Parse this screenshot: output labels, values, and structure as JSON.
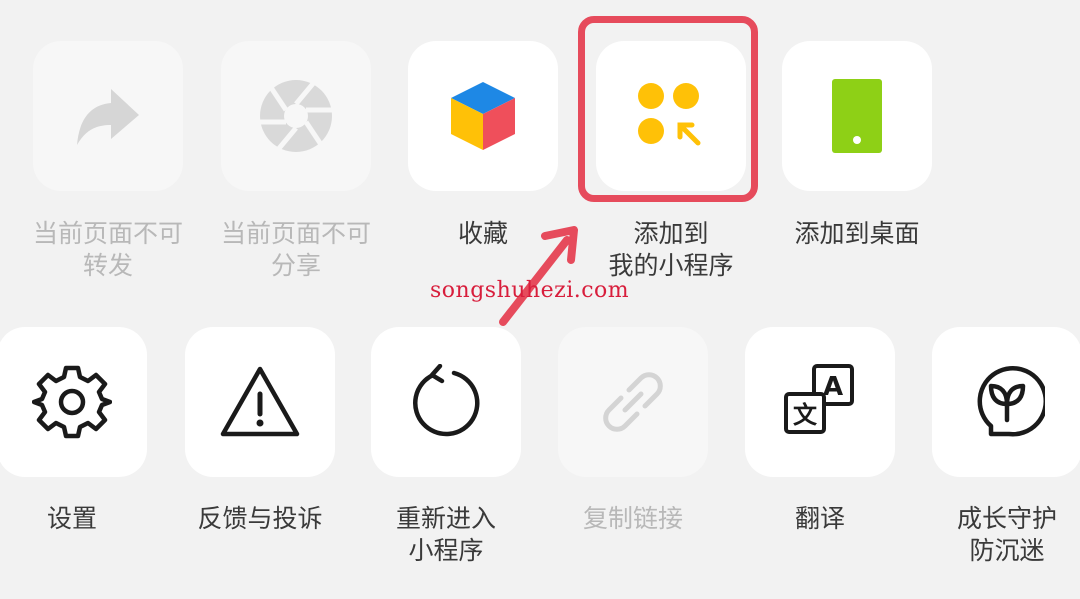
{
  "row1": [
    {
      "label": "当前页面不可\n转发",
      "icon": "forward-arrow-icon",
      "enabled": false
    },
    {
      "label": "当前页面不可\n分享",
      "icon": "shutter-share-icon",
      "enabled": false
    },
    {
      "label": "收藏",
      "icon": "colorful-cube-icon",
      "enabled": true
    },
    {
      "label": "添加到\n我的小程序",
      "icon": "mini-program-add-icon",
      "enabled": true
    },
    {
      "label": "添加到桌面",
      "icon": "phone-desktop-icon",
      "enabled": true
    }
  ],
  "row2": [
    {
      "label": "设置",
      "icon": "gear-icon",
      "enabled": true
    },
    {
      "label": "反馈与投诉",
      "icon": "warning-triangle-icon",
      "enabled": true
    },
    {
      "label": "重新进入\n小程序",
      "icon": "reload-icon",
      "enabled": true
    },
    {
      "label": "复制链接",
      "icon": "link-icon",
      "enabled": false
    },
    {
      "label": "翻译",
      "icon": "translate-icon",
      "enabled": true
    },
    {
      "label": "成长守护\n防沉迷",
      "icon": "sprout-icon",
      "enabled": true
    }
  ],
  "watermark": "songshuhezi.com",
  "colors": {
    "highlight": "#e64b5c",
    "watermark": "#d81e3c",
    "accent_yellow": "#ffc107",
    "green": "#8ed016"
  }
}
